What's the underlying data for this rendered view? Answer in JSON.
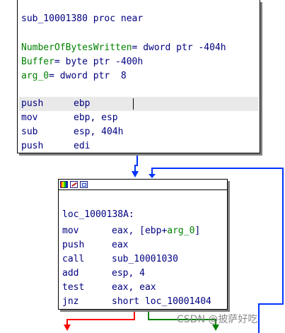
{
  "node_top": {
    "proc_header": "sub_10001380 proc near",
    "vars": [
      {
        "name": "NumberOfBytesWritten",
        "def": "= dword ptr -404h"
      },
      {
        "name": "Buffer",
        "def": "= byte ptr -400h"
      },
      {
        "name": "arg_0",
        "def": "= dword ptr  8"
      }
    ],
    "instructions": [
      {
        "mnem": "push",
        "ops": "ebp"
      },
      {
        "mnem": "mov",
        "ops": "ebp, esp"
      },
      {
        "mnem": "sub",
        "ops": "esp, 404h"
      },
      {
        "mnem": "push",
        "ops": "edi"
      }
    ]
  },
  "node_bottom": {
    "toolbar_icons": [
      "color-palette-icon",
      "edit-node-icon",
      "graph-overview-icon"
    ],
    "label": "loc_1000138A:",
    "instructions": [
      {
        "mnem": "mov",
        "ops_pre": "eax, [ebp+",
        "ops_var": "arg_0",
        "ops_post": "]"
      },
      {
        "mnem": "push",
        "ops": "eax"
      },
      {
        "mnem": "call",
        "ops": "sub_10001030"
      },
      {
        "mnem": "add",
        "ops": "esp, 4"
      },
      {
        "mnem": "test",
        "ops": "eax, eax"
      },
      {
        "mnem": "jnz",
        "ops": "short loc_10001404"
      }
    ]
  },
  "edge_colors": {
    "normal": "#0033ff",
    "loop_back": "#0033ff",
    "false_branch": "#ff0000",
    "true_branch": "#008000"
  },
  "text_colors": {
    "code": "#000080",
    "variable": "#008000"
  },
  "watermark": "CSDN @披萨好吃"
}
